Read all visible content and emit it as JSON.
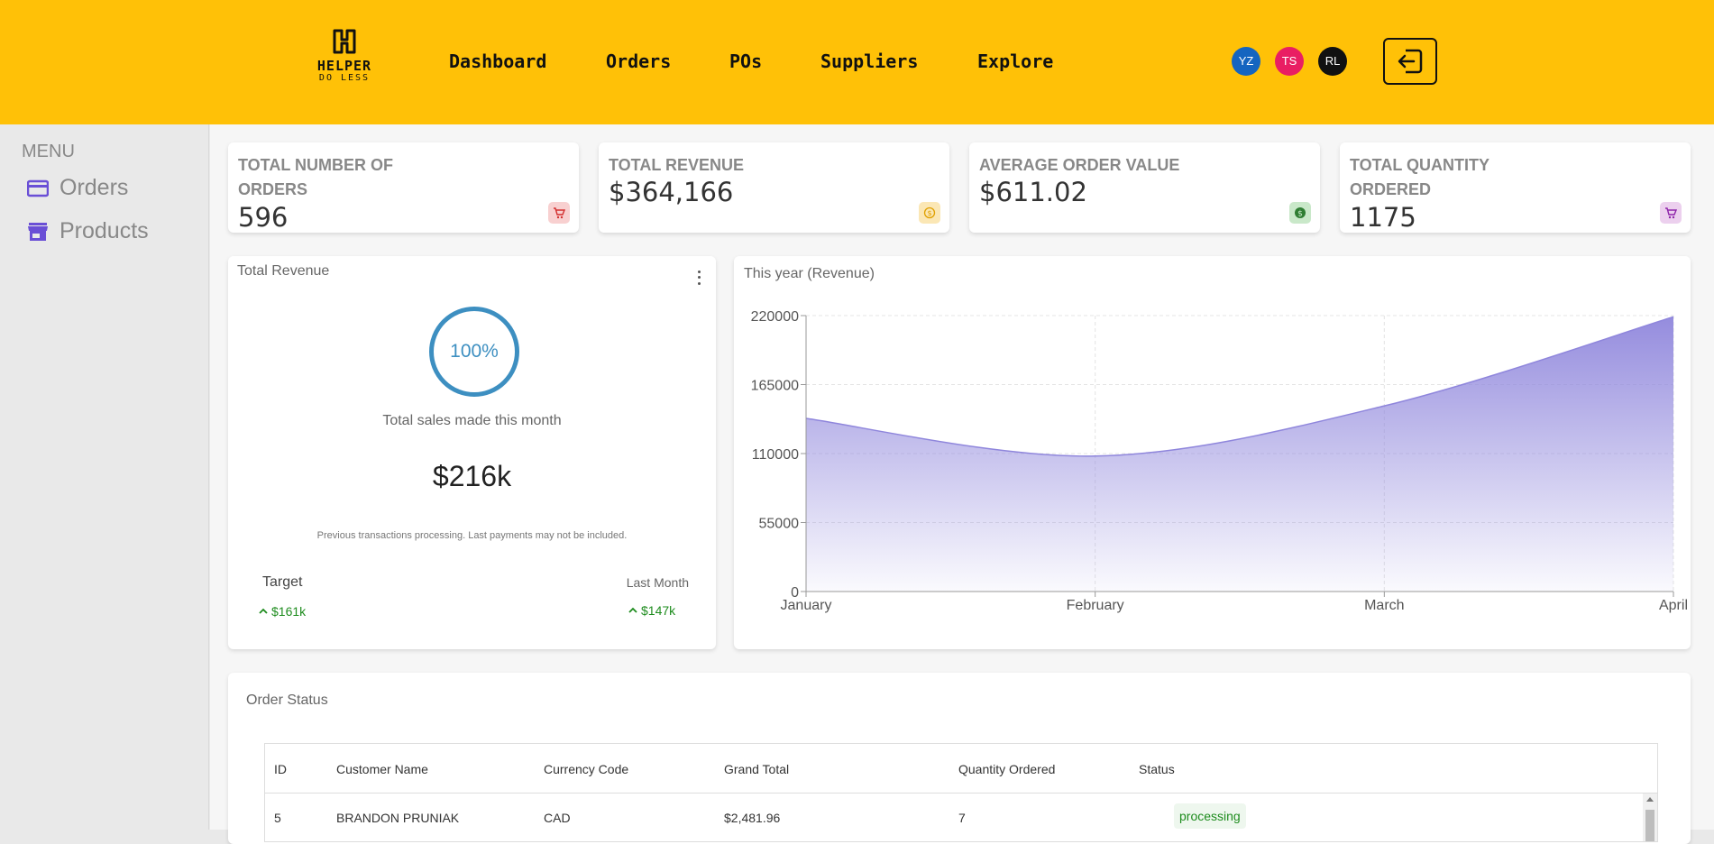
{
  "header": {
    "logo": {
      "line1": "HELPER",
      "line2": "DO LESS"
    },
    "nav": [
      "Dashboard",
      "Orders",
      "POs",
      "Suppliers",
      "Explore"
    ],
    "avatars": [
      {
        "initials": "YZ",
        "color": "#1565c0"
      },
      {
        "initials": "TS",
        "color": "#e91e63"
      },
      {
        "initials": "RL",
        "color": "#111111"
      }
    ],
    "logout_icon": "logout-icon"
  },
  "sidebar": {
    "title": "MENU",
    "items": [
      {
        "label": "Orders",
        "icon": "credit-card-icon",
        "color": "#6a4fd6"
      },
      {
        "label": "Products",
        "icon": "store-icon",
        "color": "#6a4fd6"
      }
    ]
  },
  "kpis": [
    {
      "title_line1": "TOTAL NUMBER OF",
      "title_line2": "ORDERS",
      "value": "596",
      "icon": "cart-icon",
      "icon_bg": "#f8d0d0",
      "icon_color": "#d32f2f"
    },
    {
      "title_line1": "TOTAL REVENUE",
      "title_line2": "",
      "value": "$364,166",
      "icon": "coin-icon",
      "icon_bg": "#fbe7b5",
      "icon_color": "#e0a000"
    },
    {
      "title_line1": "AVERAGE ORDER VALUE",
      "title_line2": "",
      "value": "$611.02",
      "icon": "dollar-icon",
      "icon_bg": "#c9e8c9",
      "icon_color": "#2e7d32"
    },
    {
      "title_line1": "TOTAL QUANTITY",
      "title_line2": "ORDERED",
      "value": "1175",
      "icon": "cart-icon",
      "icon_bg": "#ecd0ee",
      "icon_color": "#8e24aa"
    }
  ],
  "revenue_panel": {
    "title": "Total Revenue",
    "percent": "100%",
    "caption": "Total sales made this month",
    "amount": "$216k",
    "note": "Previous transactions processing. Last payments may not be included.",
    "target_label": "Target",
    "target_value": "$161k",
    "last_month_label": "Last Month",
    "last_month_value": "$147k",
    "up_color": "#1e8c1e"
  },
  "chart_data": {
    "type": "area",
    "title": "This year (Revenue)",
    "categories": [
      "January",
      "February",
      "March",
      "April"
    ],
    "series": [
      {
        "values": [
          138000,
          108000,
          148000,
          219000
        ]
      }
    ],
    "yticks": [
      0,
      55000,
      110000,
      165000,
      220000
    ],
    "ylim": [
      0,
      220000
    ],
    "grid": true,
    "fill_color": "#8f86dc"
  },
  "order_status": {
    "title": "Order Status",
    "columns": [
      "ID",
      "Customer Name",
      "Currency Code",
      "Grand Total",
      "Quantity Ordered",
      "Status"
    ],
    "rows": [
      [
        "5",
        "BRANDON PRUNIAK",
        "CAD",
        "$2,481.96",
        "7",
        "processing"
      ]
    ]
  }
}
